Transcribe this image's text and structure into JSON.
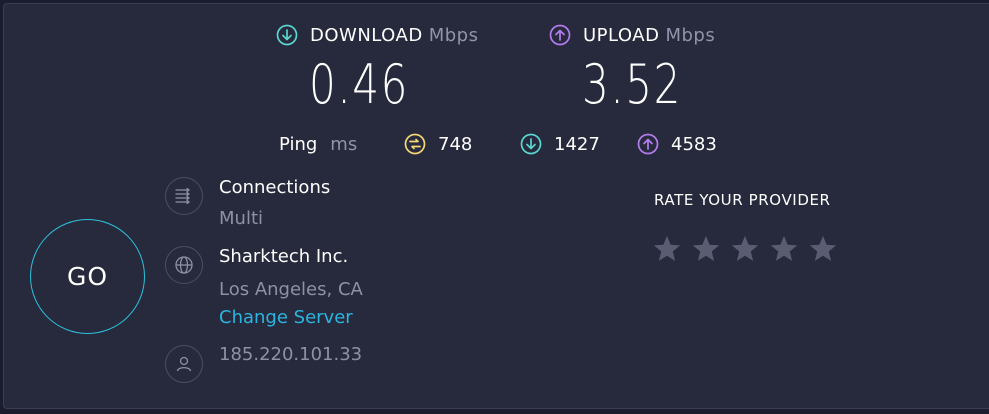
{
  "download": {
    "label": "DOWNLOAD",
    "unit": "Mbps",
    "value": "0.46",
    "icon": "arrow-down-circle-icon",
    "color": "#5ad6d0"
  },
  "upload": {
    "label": "UPLOAD",
    "unit": "Mbps",
    "value": "3.52",
    "icon": "arrow-up-circle-icon",
    "color": "#b57cf0"
  },
  "ping": {
    "label": "Ping",
    "unit": "ms",
    "idle": {
      "value": "748",
      "icon": "jitter-icon",
      "color": "#f4d774"
    },
    "download": {
      "value": "1427",
      "icon": "arrow-down-circle-icon",
      "color": "#5ad6d0"
    },
    "upload": {
      "value": "4583",
      "icon": "arrow-up-circle-icon",
      "color": "#b57cf0"
    }
  },
  "go_button": {
    "label": "GO",
    "color": "#2bc2dc"
  },
  "connections": {
    "title": "Connections",
    "value": "Multi",
    "icon": "connections-icon"
  },
  "server": {
    "name": "Sharktech Inc.",
    "location": "Los Angeles, CA",
    "change_link": "Change Server",
    "icon": "globe-icon"
  },
  "client": {
    "ip": "185.220.101.33",
    "icon": "user-icon"
  },
  "rating": {
    "title": "RATE YOUR PROVIDER",
    "star_count": 5,
    "rating": 0,
    "star_color": "#5a5d72"
  }
}
